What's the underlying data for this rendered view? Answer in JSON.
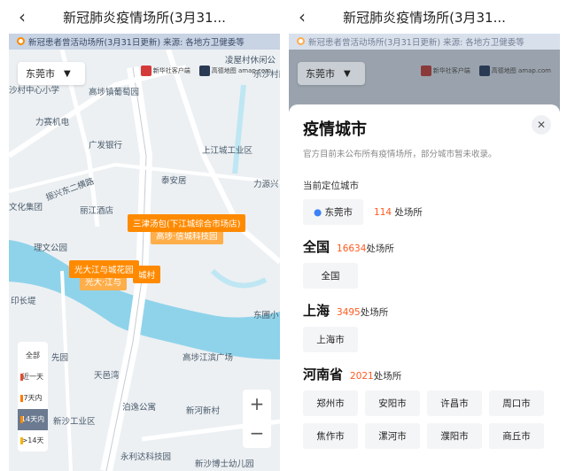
{
  "header": {
    "title": "新冠肺炎疫情场所(3月31..."
  },
  "banner": {
    "text": "新冠患者曾活动场所(3月31日更新)  来源: 各地方卫健委等"
  },
  "map": {
    "city_button": "东莞市",
    "logos": [
      "新华社客户端",
      "高德地图 amap.com"
    ],
    "labels": [
      "凌屋村休闲公",
      "乐沙村南",
      "沙村中心小学",
      "高埗镇葡萄园",
      "力赛机电",
      "广发银行",
      "上江城工业区",
      "泰安居",
      "力源兴",
      "振兴东二横路",
      "文化集团",
      "丽江酒店",
      "理文公园",
      "印长堤",
      "先园",
      "东圃小",
      "天邑湾",
      "高埗江滨广场",
      "泊逸公寓",
      "新沙工业区",
      "新河新村",
      "永利达科技园",
      "新沙博士幼儿园"
    ],
    "pins": [
      "三津汤包(下江城综合市场店)",
      "光大江与城花园",
      "城村",
      "高埗·信城科技园",
      "光大·江与"
    ],
    "legend": [
      {
        "label": "全部"
      },
      {
        "label": "近一天"
      },
      {
        "label": "7天内"
      },
      {
        "label": "14天内"
      },
      {
        "label": ">14天"
      }
    ],
    "legend_colors": [
      "#e84a2f",
      "#ff7a00",
      "#ff8a00",
      "#f5b400"
    ],
    "zoom": {
      "in": "+",
      "out": "−"
    }
  },
  "sheet": {
    "title": "疫情城市",
    "subtitle": "官方目前未公布所有疫情场所，部分城市暂未收录。",
    "current_label": "当前定位城市",
    "current_city": "东莞市",
    "current_count": "114",
    "current_unit": "处场所",
    "areas": [
      {
        "name": "全国",
        "count": "16634",
        "unit": "处场所",
        "cities": [
          "全国"
        ]
      },
      {
        "name": "上海",
        "count": "3495",
        "unit": "处场所",
        "cities": [
          "上海市"
        ]
      },
      {
        "name": "河南省",
        "count": "2021",
        "unit": "处场所",
        "cities": [
          "郑州市",
          "安阳市",
          "许昌市",
          "周口市",
          "焦作市",
          "漯河市",
          "濮阳市",
          "商丘市"
        ]
      }
    ]
  }
}
